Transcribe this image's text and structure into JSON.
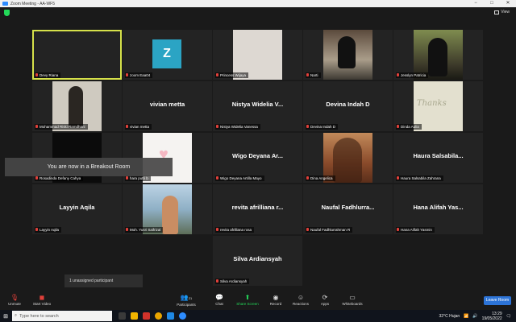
{
  "window": {
    "title": "Zoom Meeting - AA-WF5",
    "controls": [
      "−",
      "□",
      "✕"
    ]
  },
  "view": {
    "label": "View"
  },
  "tiles": [
    {
      "label": "Devy Riana",
      "active": true
    },
    {
      "label": "zoom Eaa04",
      "avatar": "Z"
    },
    {
      "label": "Princess Wijaya"
    },
    {
      "label": "Narti"
    },
    {
      "label": "Jesslyn Patricia"
    },
    {
      "label": "Mohammad Riski Ramdhani"
    },
    {
      "label": "vivian metta",
      "big": "vivian metta"
    },
    {
      "label": "Nistya Widelia Vanessa",
      "big": "Nistya Widelia V..."
    },
    {
      "label": "Devina Indah D",
      "big": "Devina Indah D"
    },
    {
      "label": "Dinda Aulia",
      "thanks": "Thanks"
    },
    {
      "label": "Rosadinda Defany Cahya"
    },
    {
      "label": "hara putri b"
    },
    {
      "label": "Wigo Deyana Artilla Mayo",
      "big": "Wigo Deyana Ar..."
    },
    {
      "label": "Dina Angelica"
    },
    {
      "label": "Haura Salsabila Zahrana",
      "big": "Haura Salsabila..."
    },
    {
      "label": "Layyin Aqila",
      "big": "Layyin Aqila"
    },
    {
      "label": "Moh. Yusri Saifrizal"
    },
    {
      "label": "revita afrilliana rosa",
      "big": "revita afrilliana r..."
    },
    {
      "label": "Naufal Fadhlurrahman R",
      "big": "Naufal Fadhlurra..."
    },
    {
      "label": "Hana Alifah Yasmin",
      "big": "Hana Alifah Yas..."
    },
    {
      "label": "Silva Ardiansyah",
      "big": "Silva Ardiansyah"
    }
  ],
  "breakout": {
    "text": "You are now in a Breakout Room"
  },
  "unassigned": {
    "text": "1 unassigned participant"
  },
  "toolbar": {
    "unmute": "Unmute",
    "start_video": "Start Video",
    "participants": "Participants",
    "participants_count": "21",
    "chat": "Chat",
    "share_screen": "Share Screen",
    "record": "Record",
    "reactions": "Reactions",
    "apps": "Apps",
    "whiteboards": "Whiteboards",
    "leave": "Leave Room"
  },
  "taskbar": {
    "search_placeholder": "Type here to search",
    "weather": "32°C Hujan",
    "time": "13:29",
    "date": "19/05/2022"
  },
  "colors": {
    "accent": "#2d74d7",
    "active_border": "#d6e14a",
    "green": "#23d959",
    "red": "#e0403a"
  }
}
